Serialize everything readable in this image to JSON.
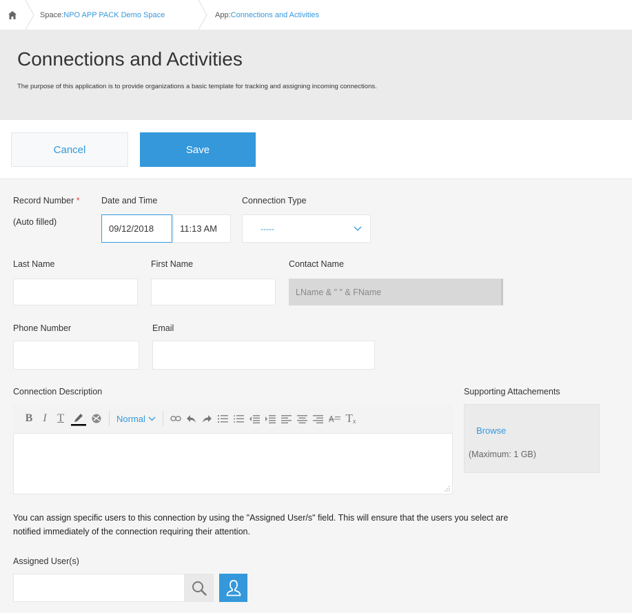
{
  "breadcrumb": {
    "space_prefix": "Space: ",
    "space_name": "NPO APP PACK Demo Space",
    "app_prefix": "App: ",
    "app_name": "Connections and Activities"
  },
  "header": {
    "title": "Connections and Activities",
    "description": "The purpose of this application is to provide organizations a basic template for tracking and assigning incoming connections."
  },
  "actions": {
    "cancel_label": "Cancel",
    "save_label": "Save"
  },
  "fields": {
    "record_number": {
      "label": "Record Number",
      "required_mark": "*",
      "value": "(Auto filled)"
    },
    "date_time": {
      "label": "Date and Time",
      "date_value": "09/12/2018",
      "time_value": "11:13 AM"
    },
    "connection_type": {
      "label": "Connection Type",
      "selected": "-----"
    },
    "last_name": {
      "label": "Last Name",
      "value": ""
    },
    "first_name": {
      "label": "First Name",
      "value": ""
    },
    "contact_name": {
      "label": "Contact Name",
      "formula": "LName & \" \" & FName"
    },
    "phone_number": {
      "label": "Phone Number",
      "value": ""
    },
    "email": {
      "label": "Email",
      "value": ""
    },
    "connection_description": {
      "label": "Connection Description",
      "format_label": "Normal"
    },
    "attachments": {
      "label": "Supporting Attachements",
      "browse_label": "Browse",
      "max_size": "(Maximum: 1 GB)"
    },
    "assigned_users": {
      "label": "Assigned User(s)",
      "value": ""
    }
  },
  "note": "You can assign specific users to this connection by using the \"Assigned User/s\" field. This will ensure that the users you select are notified immediately of the connection requiring their attention.",
  "colors": {
    "accent": "#3498db",
    "required": "#e74c3c",
    "header_bg": "#ebebeb",
    "page_bg": "#f5f5f5"
  },
  "icons": {
    "breadcrumb_home": "home-icon",
    "dropdown": "chevron-down-icon",
    "search": "search-icon",
    "user_picker": "user-icon",
    "editor_toolbar": [
      "bold-icon",
      "italic-icon",
      "underline-icon",
      "font-color-icon",
      "background-color-icon",
      "link-icon",
      "undo-icon",
      "redo-icon",
      "numbered-list-icon",
      "bullet-list-icon",
      "indent-decrease-icon",
      "indent-increase-icon",
      "align-left-icon",
      "align-center-icon",
      "align-right-icon",
      "strikethrough-icon",
      "clear-format-icon"
    ]
  }
}
